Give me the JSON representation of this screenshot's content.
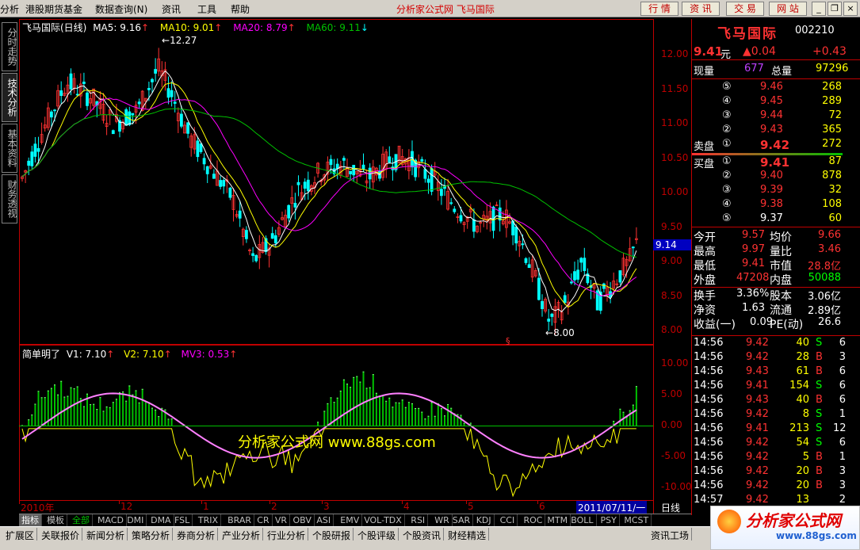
{
  "menu": {
    "items": [
      "分析",
      "港股期货基金",
      "数据查询(N)",
      "资讯",
      "工具",
      "帮助"
    ],
    "center_title": "分析家公式网  飞马国际",
    "quick_buttons": [
      "行 情",
      "资 讯",
      "交 易",
      "网 站"
    ]
  },
  "side_tabs": [
    "分时走势",
    "技术分析",
    "基本资料",
    "财务透视"
  ],
  "main_chart": {
    "legend_title": "飞马国际(日线)",
    "ma5": "MA5: 9.16",
    "ma10": "MA10: 9.01",
    "ma20": "MA20: 8.79",
    "ma60": "MA60: 9.11",
    "high_marker": "12.27",
    "low_marker": "8.00",
    "current_price_tag": "9.14",
    "y_ticks": [
      "12.00",
      "11.50",
      "11.00",
      "10.50",
      "10.00",
      "9.50",
      "9.00",
      "8.50",
      "8.00"
    ],
    "colors": {
      "up": "#ff3232",
      "down": "#00ffff",
      "ma5": "#ffffff",
      "ma10": "#ffff00",
      "ma20": "#ff00ff",
      "ma60": "#00c000"
    }
  },
  "indicator": {
    "legend_title": "简单明了",
    "v1": "V1: 7.10",
    "v2": "V2: 7.10",
    "mv3": "MV3: 0.53",
    "y_ticks": [
      "10.00",
      "5.00",
      "0.00",
      "-5.00",
      "-10.00"
    ],
    "watermark": "分析家公式网 www.88gs.com"
  },
  "x_axis": {
    "labels": [
      "2010年",
      "12",
      "1",
      "2",
      "3",
      "4",
      "5",
      "6"
    ],
    "date_highlight": "2011/07/11/一",
    "period": "日线"
  },
  "indicator_tabs": [
    "指标",
    "模板",
    "全部",
    "MACD",
    "DMI",
    "DMA",
    "FSL",
    "TRIX",
    "BRAR",
    "CR",
    "VR",
    "OBV",
    "ASI",
    "EMV",
    "VOL-TDX",
    "RSI",
    "WR",
    "SAR",
    "KDJ",
    "CCI",
    "ROC",
    "MTM",
    "BOLL",
    "PSY",
    "MCST"
  ],
  "categories": [
    "扩展区",
    "关联报价",
    "新闻分析",
    "策略分析",
    "券商分析",
    "产业分析",
    "行业分析",
    "个股研报",
    "个股评级",
    "个股资讯",
    "财经精选"
  ],
  "category_right": "资讯工场",
  "stock_panel": {
    "name": "飞马国际",
    "code": "002210",
    "price": "9.41",
    "price_unit": "元",
    "change": "▲0.04",
    "change_pct": "+0.43",
    "current_vol_label": "现量",
    "current_vol": "677",
    "total_vol_label": "总量",
    "total_vol": "97296",
    "sell": [
      {
        "lvl": "⑤",
        "price": "9.46",
        "vol": "268"
      },
      {
        "lvl": "④",
        "price": "9.45",
        "vol": "289"
      },
      {
        "lvl": "③",
        "price": "9.44",
        "vol": "72"
      },
      {
        "lvl": "②",
        "price": "9.43",
        "vol": "365"
      },
      {
        "lvl": "①",
        "price": "9.42",
        "vol": "272",
        "label": "卖盘"
      }
    ],
    "buy": [
      {
        "lvl": "①",
        "price": "9.41",
        "vol": "87",
        "label": "买盘"
      },
      {
        "lvl": "②",
        "price": "9.40",
        "vol": "878"
      },
      {
        "lvl": "③",
        "price": "9.39",
        "vol": "32"
      },
      {
        "lvl": "④",
        "price": "9.38",
        "vol": "108"
      },
      {
        "lvl": "⑤",
        "price": "9.37",
        "vol": "60"
      }
    ],
    "stats": [
      {
        "l1": "今开",
        "v1": "9.57",
        "l2": "均价",
        "v2": "9.66"
      },
      {
        "l1": "最高",
        "v1": "9.97",
        "l2": "量比",
        "v2": "3.46"
      },
      {
        "l1": "最低",
        "v1": "9.41",
        "l2": "市值",
        "v2": "28.8亿"
      },
      {
        "l1": "外盘",
        "v1": "47208",
        "l2": "内盘",
        "v2": "50088"
      },
      {
        "l1": "换手",
        "v1": "3.36%",
        "l2": "股本",
        "v2": "3.06亿"
      },
      {
        "l1": "净资",
        "v1": "1.63",
        "l2": "流通",
        "v2": "2.89亿"
      },
      {
        "l1": "收益(一)",
        "v1": "0.09",
        "l2": "PE(动)",
        "v2": "26.6"
      }
    ],
    "ticks": [
      {
        "t": "14:56",
        "p": "9.42",
        "v": "40",
        "s": "S",
        "n": "6"
      },
      {
        "t": "14:56",
        "p": "9.42",
        "v": "28",
        "s": "B",
        "n": "3"
      },
      {
        "t": "14:56",
        "p": "9.43",
        "v": "61",
        "s": "B",
        "n": "6"
      },
      {
        "t": "14:56",
        "p": "9.41",
        "v": "154",
        "s": "S",
        "n": "6"
      },
      {
        "t": "14:56",
        "p": "9.43",
        "v": "40",
        "s": "B",
        "n": "6"
      },
      {
        "t": "14:56",
        "p": "9.42",
        "v": "8",
        "s": "S",
        "n": "1"
      },
      {
        "t": "14:56",
        "p": "9.41",
        "v": "213",
        "s": "S",
        "n": "12"
      },
      {
        "t": "14:56",
        "p": "9.42",
        "v": "54",
        "s": "S",
        "n": "6"
      },
      {
        "t": "14:56",
        "p": "9.42",
        "v": "5",
        "s": "B",
        "n": "1"
      },
      {
        "t": "14:56",
        "p": "9.42",
        "v": "20",
        "s": "B",
        "n": "3"
      },
      {
        "t": "14:56",
        "p": "9.42",
        "v": "20",
        "s": "B",
        "n": "3"
      },
      {
        "t": "14:57",
        "p": "9.42",
        "v": "13",
        "s": "",
        "n": "2"
      }
    ]
  },
  "logo_text": "分析家公式网",
  "logo_url": "www.88gs.com"
}
